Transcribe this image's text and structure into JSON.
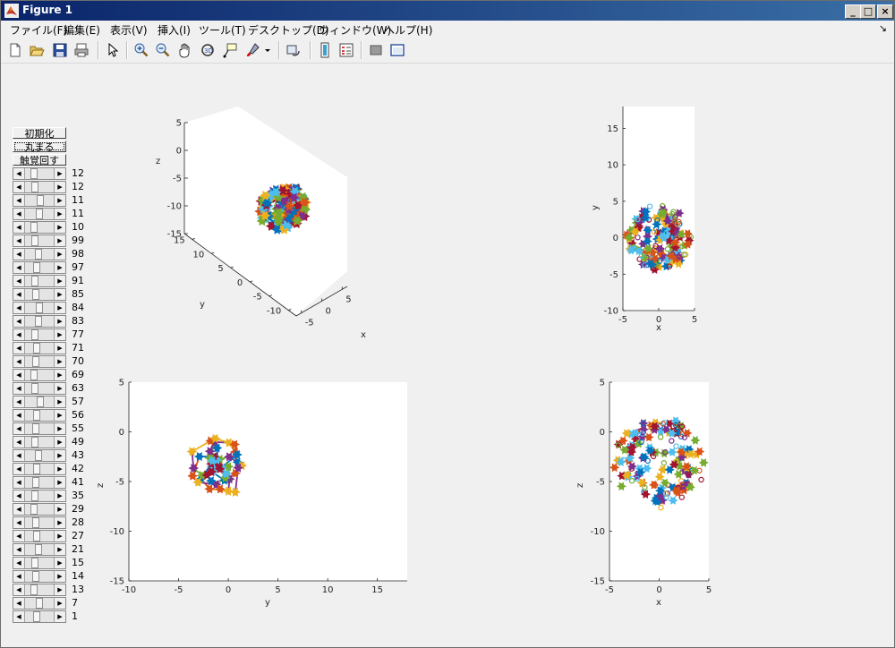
{
  "window": {
    "title": "Figure 1",
    "controls": [
      "_",
      "□",
      "×"
    ]
  },
  "menu": {
    "items": [
      "ファイル(F)",
      "編集(E)",
      "表示(V)",
      "挿入(I)",
      "ツール(T)",
      "デスクトップ(D)",
      "ウィンドウ(W)",
      "ヘルプ(H)"
    ],
    "dock_glyph": "↘"
  },
  "toolbar": {
    "icons": [
      "new-figure-icon",
      "open-file-icon",
      "save-icon",
      "print-icon",
      "edit-plot-icon",
      "zoom-in-icon",
      "zoom-out-icon",
      "pan-icon",
      "rotate-3d-icon",
      "data-cursor-icon",
      "brush-icon",
      "brush-dropdown-icon",
      "link-plot-icon",
      "insert-colorbar-icon",
      "insert-legend-icon",
      "hide-plot-tools-icon",
      "show-plot-tools-icon"
    ]
  },
  "controls": {
    "init_label": "初期化",
    "round_label": "丸まる",
    "tactile_label": "触覚回す",
    "slider_values": [
      "12",
      "12",
      "11",
      "11",
      "10",
      "99",
      "98",
      "97",
      "91",
      "85",
      "84",
      "83",
      "77",
      "71",
      "70",
      "69",
      "63",
      "57",
      "56",
      "55",
      "49",
      "43",
      "42",
      "41",
      "35",
      "29",
      "28",
      "27",
      "21",
      "15",
      "14",
      "13",
      "7",
      "1"
    ],
    "slider_positions": [
      0.25,
      0.3,
      0.55,
      0.5,
      0.25,
      0.3,
      0.45,
      0.4,
      0.3,
      0.35,
      0.5,
      0.45,
      0.3,
      0.4,
      0.35,
      0.25,
      0.3,
      0.55,
      0.4,
      0.35,
      0.3,
      0.45,
      0.4,
      0.35,
      0.3,
      0.25,
      0.35,
      0.4,
      0.45,
      0.3,
      0.35,
      0.25,
      0.5,
      0.4
    ]
  },
  "colors": {
    "series": [
      "#0072bd",
      "#d95319",
      "#edb120",
      "#7e2f8e",
      "#77ac30",
      "#4dbeee",
      "#a2142f"
    ]
  },
  "chart_data": [
    {
      "type": "scatter",
      "name": "3d-view",
      "xlabel": "x",
      "ylabel": "y",
      "zlabel": "z",
      "x_ticks": [
        "5",
        "0",
        "-5"
      ],
      "y_ticks": [
        "15",
        "10",
        "5",
        "0",
        "-5",
        "-10"
      ],
      "z_ticks": [
        "5",
        "0",
        "-5",
        "-10",
        "-15"
      ]
    },
    {
      "type": "scatter",
      "name": "xy-view",
      "xlabel": "x",
      "ylabel": "y",
      "x_ticks": [
        "-5",
        "0",
        "5"
      ],
      "y_ticks": [
        "15",
        "10",
        "5",
        "0",
        "-5",
        "-10"
      ],
      "xlim": [
        -5,
        5
      ],
      "ylim": [
        -10,
        18
      ]
    },
    {
      "type": "scatter",
      "name": "yz-view",
      "xlabel": "y",
      "ylabel": "z",
      "x_ticks": [
        "-10",
        "-5",
        "0",
        "5",
        "10",
        "15"
      ],
      "y_ticks": [
        "5",
        "0",
        "-5",
        "-10",
        "-15"
      ],
      "xlim": [
        -10,
        18
      ],
      "ylim": [
        -15,
        5
      ]
    },
    {
      "type": "scatter",
      "name": "xz-view",
      "xlabel": "x",
      "ylabel": "z",
      "x_ticks": [
        "-5",
        "0",
        "5"
      ],
      "y_ticks": [
        "5",
        "0",
        "-5",
        "-10",
        "-15"
      ],
      "xlim": [
        -5,
        5
      ],
      "ylim": [
        -15,
        5
      ]
    }
  ]
}
